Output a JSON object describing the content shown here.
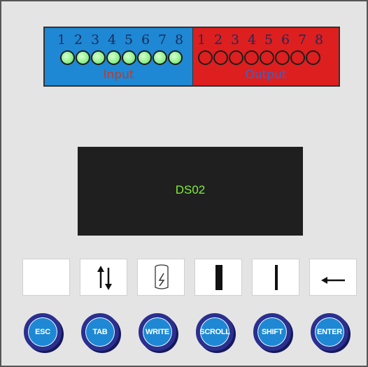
{
  "io_panel": {
    "input": {
      "label": "Input",
      "numbers": [
        "1",
        "2",
        "3",
        "4",
        "5",
        "6",
        "7",
        "8"
      ]
    },
    "output": {
      "label": "Output",
      "numbers": [
        "1",
        "2",
        "3",
        "4",
        "5",
        "6",
        "7",
        "8"
      ]
    }
  },
  "display": {
    "text": "DS02"
  },
  "icon_keys": [
    {
      "icon": "blank-icon"
    },
    {
      "icon": "up-down-arrows-icon"
    },
    {
      "icon": "write-memory-icon"
    },
    {
      "icon": "thick-bar-icon"
    },
    {
      "icon": "thin-bar-icon"
    },
    {
      "icon": "enter-arrow-icon"
    }
  ],
  "buttons": {
    "esc": "ESC",
    "tab": "TAB",
    "write": "WRITE",
    "scroll": "SCROLL",
    "shift": "SHIFT",
    "enter": "ENTER"
  },
  "colors": {
    "input_bg": "#1e88d4",
    "output_bg": "#dd1f1f",
    "led_green": "#8ff08a",
    "display_text": "#7cf03a",
    "button_blue": "#1e88d4",
    "button_ring": "#2b2f8f"
  }
}
